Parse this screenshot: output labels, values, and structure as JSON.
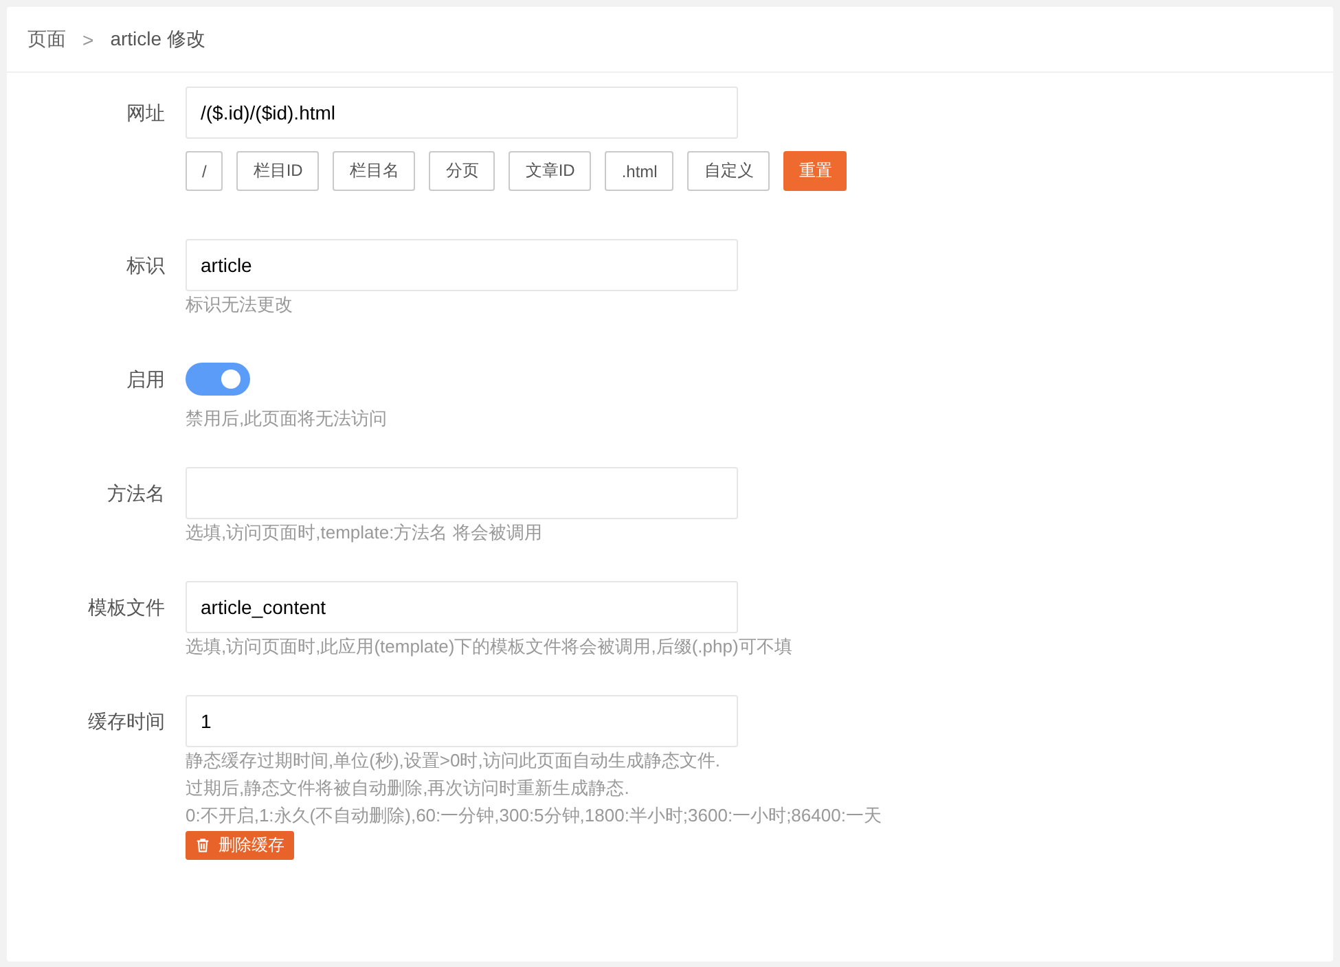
{
  "breadcrumb": {
    "items": [
      "页面",
      "article 修改"
    ],
    "separator": ">"
  },
  "fields": [
    {
      "kind": "input",
      "label": "网址",
      "value": "/($.id)/($id).html",
      "buttons": [
        {
          "label": "/",
          "kind": "plain"
        },
        {
          "label": "栏目ID",
          "kind": "plain"
        },
        {
          "label": "栏目名",
          "kind": "plain"
        },
        {
          "label": "分页",
          "kind": "plain"
        },
        {
          "label": "文章ID",
          "kind": "plain"
        },
        {
          "label": ".html",
          "kind": "plain"
        },
        {
          "label": "自定义",
          "kind": "plain"
        },
        {
          "label": "重置",
          "kind": "danger"
        }
      ]
    },
    {
      "kind": "input",
      "label": "标识",
      "value": "article",
      "hints": [
        "标识无法更改"
      ]
    },
    {
      "kind": "switch",
      "label": "启用",
      "on": true,
      "hints": [
        "禁用后,此页面将无法访问"
      ]
    },
    {
      "kind": "input",
      "label": "方法名",
      "hints": [
        "选填,访问页面时,template:方法名 将会被调用"
      ]
    },
    {
      "kind": "input",
      "label": "模板文件",
      "value": "article_content",
      "hints": [
        "选填,访问页面时,此应用(template)下的模板文件将会被调用,后缀(.php)可不填"
      ]
    },
    {
      "kind": "input",
      "label": "缓存时间",
      "value": "1",
      "hints": [
        "静态缓存过期时间,单位(秒),设置>0时,访问此页面自动生成静态文件.",
        "过期后,静态文件将被自动删除,再次访问时重新生成静态.",
        "0:不开启,1:永久(不自动删除),60:一分钟,300:5分钟,1800:半小时;3600:一小时;86400:一天"
      ],
      "action": {
        "label": "删除缓存"
      }
    }
  ]
}
